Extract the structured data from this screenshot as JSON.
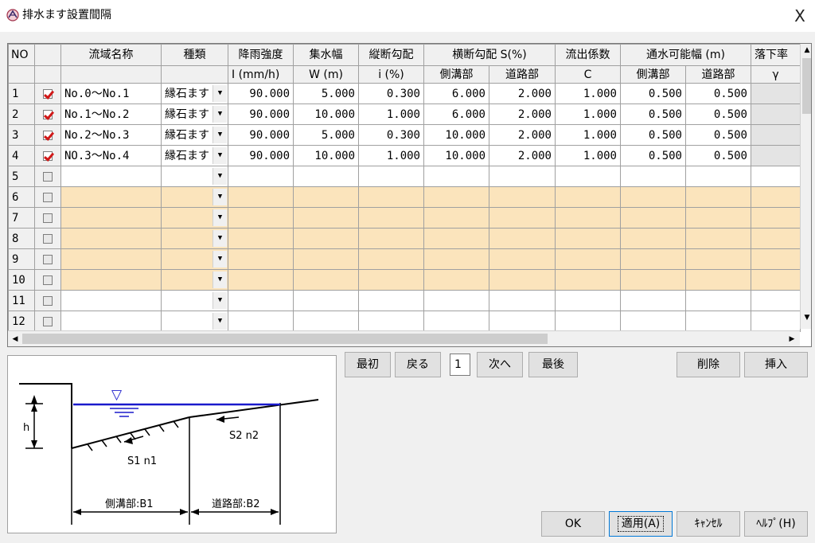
{
  "window": {
    "title": "排水ます設置間隔",
    "close_glyph": "X"
  },
  "grid": {
    "header_row1": {
      "no": "NO",
      "name": "流域名称",
      "type": "種類",
      "rain": "降雨強度",
      "width": "集水幅",
      "longslope": "縦断勾配",
      "crossslope": "横断勾配 S(%)",
      "runoff": "流出係数",
      "passable": "通水可能幅 (m)",
      "fall": "落下率"
    },
    "header_row2": {
      "rain": "I (mm/h)",
      "width": "W (m)",
      "longslope": "i (%)",
      "cross_gutter": "側溝部",
      "cross_road": "道路部",
      "runoff": "C",
      "pass_gutter": "側溝部",
      "pass_road": "道路部",
      "fall": "γ"
    },
    "rows": [
      {
        "no": "1",
        "checked": true,
        "name": "No.0～No.1",
        "type": "縁石ます",
        "rain": "90.000",
        "width": "5.000",
        "i": "0.300",
        "s_gutter": "6.000",
        "s_road": "2.000",
        "c": "1.000",
        "b_gutter": "0.500",
        "b_road": "0.500"
      },
      {
        "no": "2",
        "checked": true,
        "name": "No.1～No.2",
        "type": "縁石ます",
        "rain": "90.000",
        "width": "10.000",
        "i": "1.000",
        "s_gutter": "6.000",
        "s_road": "2.000",
        "c": "1.000",
        "b_gutter": "0.500",
        "b_road": "0.500"
      },
      {
        "no": "3",
        "checked": true,
        "name": "No.2～No.3",
        "type": "縁石ます",
        "rain": "90.000",
        "width": "5.000",
        "i": "0.300",
        "s_gutter": "10.000",
        "s_road": "2.000",
        "c": "1.000",
        "b_gutter": "0.500",
        "b_road": "0.500"
      },
      {
        "no": "4",
        "checked": true,
        "name": "NO.3～No.4",
        "type": "縁石ます",
        "rain": "90.000",
        "width": "10.000",
        "i": "1.000",
        "s_gutter": "10.000",
        "s_road": "2.000",
        "c": "1.000",
        "b_gutter": "0.500",
        "b_road": "0.500"
      },
      {
        "no": "5",
        "checked": false
      },
      {
        "no": "6",
        "checked": false
      },
      {
        "no": "7",
        "checked": false
      },
      {
        "no": "8",
        "checked": false
      },
      {
        "no": "9",
        "checked": false
      },
      {
        "no": "10",
        "checked": false
      },
      {
        "no": "11",
        "checked": false
      },
      {
        "no": "12",
        "checked": false
      }
    ],
    "highlight_color": "#fbe4bc",
    "check_color": "#d01818"
  },
  "nav": {
    "first": "最初",
    "back": "戻る",
    "page": "1",
    "next": "次へ",
    "last": "最後",
    "delete": "削除",
    "insert": "挿入"
  },
  "diagram": {
    "water_symbol": "▽",
    "h_label": "h",
    "s1_label": "S1 n1",
    "s2_label": "S2 n2",
    "b1_label": "側溝部:B1",
    "b2_label": "道路部:B2",
    "water_color": "#1a1acc"
  },
  "footer": {
    "ok": "OK",
    "apply": "適用(A)",
    "cancel": "ｷｬﾝｾﾙ",
    "help": "ﾍﾙﾌﾟ(H)"
  }
}
